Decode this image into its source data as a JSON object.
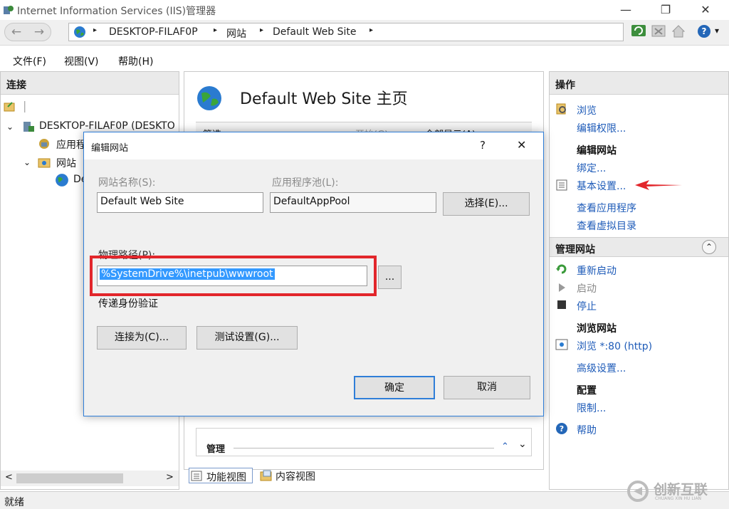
{
  "window": {
    "title": "Internet Information Services (IIS)管理器",
    "min": "—",
    "max": "❐",
    "close": "✕"
  },
  "address": {
    "back": "←",
    "forward": "→",
    "sep": "▸",
    "crumbs": [
      "DESKTOP-FILAF0P",
      "网站",
      "Default Web Site"
    ],
    "help_dropdown": "▾"
  },
  "menu": [
    "文件(F)",
    "视图(V)",
    "帮助(H)"
  ],
  "left": {
    "header": "连接",
    "tree": [
      "DESKTOP-FILAF0P (DESKTO",
      "应用程",
      "网站",
      "De"
    ],
    "expand": [
      "⌄",
      "⌄"
    ],
    "scroll_left": "<",
    "scroll_right": ">"
  },
  "middle": {
    "title": "Default Web Site 主页",
    "filter_partial": "筛选:",
    "go_partial": "开始(G)",
    "showall_partial": "全部显示(A)",
    "section_manage": "管理",
    "collapse": "⌃",
    "scroll_down": "⌄",
    "tabs": [
      "功能视图",
      "内容视图"
    ]
  },
  "right": {
    "header": "操作",
    "actions": [
      {
        "label": "浏览",
        "kind": "link"
      },
      {
        "label": "编辑权限...",
        "kind": "link"
      },
      {
        "label": "编辑网站",
        "kind": "header"
      },
      {
        "label": "绑定...",
        "kind": "link"
      },
      {
        "label": "基本设置...",
        "kind": "link"
      },
      {
        "label": "查看应用程序",
        "kind": "link"
      },
      {
        "label": "查看虚拟目录",
        "kind": "link"
      }
    ],
    "manage_header": "管理网站",
    "collapse": "⌃",
    "manage_actions": [
      "重新启动",
      "启动",
      "停止"
    ],
    "browse_header": "浏览网站",
    "browse_link": "浏览 *:80 (http)",
    "advanced": "高级设置...",
    "config_header": "配置",
    "limits": "限制...",
    "help": "帮助"
  },
  "status": "就绪",
  "dialog": {
    "title": "编辑网站",
    "help": "?",
    "close": "✕",
    "site_name_label": "网站名称(S):",
    "site_name_value": "Default Web Site",
    "app_pool_label": "应用程序池(L):",
    "app_pool_value": "DefaultAppPool",
    "select_button": "选择(E)...",
    "physical_path_label": "物理路径(P):",
    "physical_path_value": "%SystemDrive%\\inetpub\\wwwroot",
    "browse_button": "...",
    "pass_through": "传递身份验证",
    "connect_as_button": "连接为(C)...",
    "test_settings_button": "测试设置(G)...",
    "ok_button": "确定",
    "cancel_button": "取消"
  },
  "watermark": {
    "main": "创新互联",
    "sub": "CHUANG XIN HU LIAN"
  },
  "colors": {
    "link": "#1e5bb8",
    "highlight": "#e2262b",
    "selection": "#3399ff"
  }
}
